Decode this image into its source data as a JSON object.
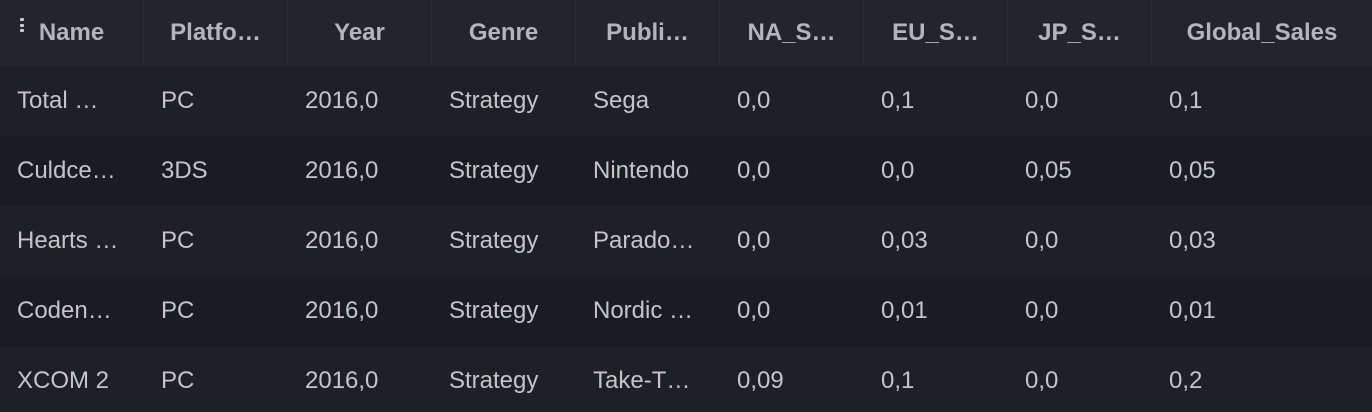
{
  "table": {
    "columns": [
      "Name",
      "Platfo…",
      "Year",
      "Genre",
      "Publi…",
      "NA_S…",
      "EU_S…",
      "JP_S…",
      "Global_Sales"
    ],
    "rows": [
      [
        "Total …",
        "PC",
        "2016,0",
        "Strategy",
        "Sega",
        "0,0",
        "0,1",
        "0,0",
        "0,1"
      ],
      [
        "Culdce…",
        "3DS",
        "2016,0",
        "Strategy",
        "Nintendo",
        "0,0",
        "0,0",
        "0,05",
        "0,05"
      ],
      [
        "Hearts …",
        "PC",
        "2016,0",
        "Strategy",
        "Parado…",
        "0,0",
        "0,03",
        "0,0",
        "0,03"
      ],
      [
        "Coden…",
        "PC",
        "2016,0",
        "Strategy",
        "Nordic …",
        "0,0",
        "0,01",
        "0,0",
        "0,01"
      ],
      [
        "XCOM 2",
        "PC",
        "2016,0",
        "Strategy",
        "Take-T…",
        "0,09",
        "0,1",
        "0,0",
        "0,2"
      ]
    ]
  },
  "icons": {
    "column_menu": "kebab-menu-icon"
  },
  "colors": {
    "background": "#1b1c21",
    "header_background": "#24252b",
    "row_alt_background": "#1f2025",
    "text": "#c4c5ca",
    "header_text": "#b3b5bb"
  }
}
